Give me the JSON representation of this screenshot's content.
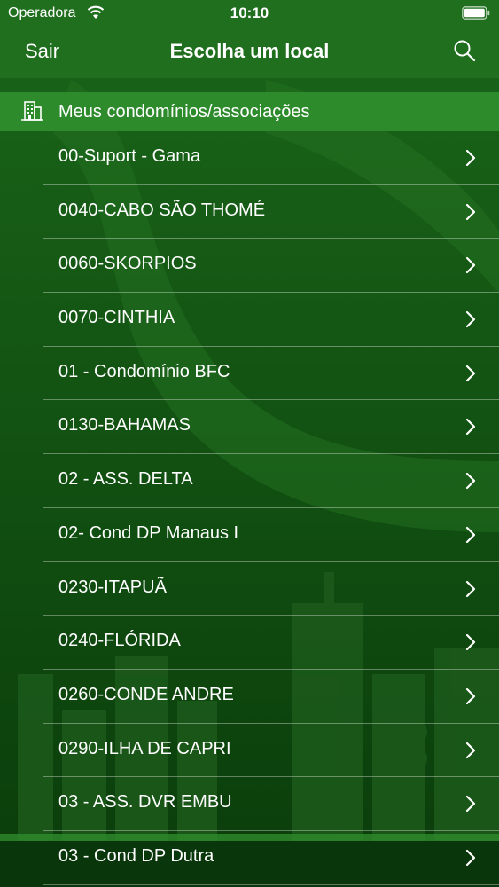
{
  "status_bar": {
    "carrier": "Operadora",
    "time": "10:10"
  },
  "navbar": {
    "left_button": "Sair",
    "title": "Escolha um local",
    "search_icon": "search-icon"
  },
  "section": {
    "label": "Meus condomínios/associações",
    "icon": "building-icon"
  },
  "items": [
    {
      "label": "00-Suport - Gama"
    },
    {
      "label": "0040-CABO SÃO THOMÉ"
    },
    {
      "label": "0060-SKORPIOS"
    },
    {
      "label": "0070-CINTHIA"
    },
    {
      "label": "01 - Condomínio BFC"
    },
    {
      "label": "0130-BAHAMAS"
    },
    {
      "label": "02 - ASS. DELTA"
    },
    {
      "label": "02- Cond DP Manaus I"
    },
    {
      "label": "0230-ITAPUÃ"
    },
    {
      "label": "0240-FLÓRIDA"
    },
    {
      "label": "0260-CONDE ANDRE"
    },
    {
      "label": "0290-ILHA DE CAPRI"
    },
    {
      "label": "03 - ASS. DVR EMBU"
    },
    {
      "label": "03 - Cond DP Dutra"
    }
  ],
  "colors": {
    "bar_green": "#1f6f1e",
    "section_green": "#2e8b2c",
    "background_green": "#0f4a10"
  }
}
